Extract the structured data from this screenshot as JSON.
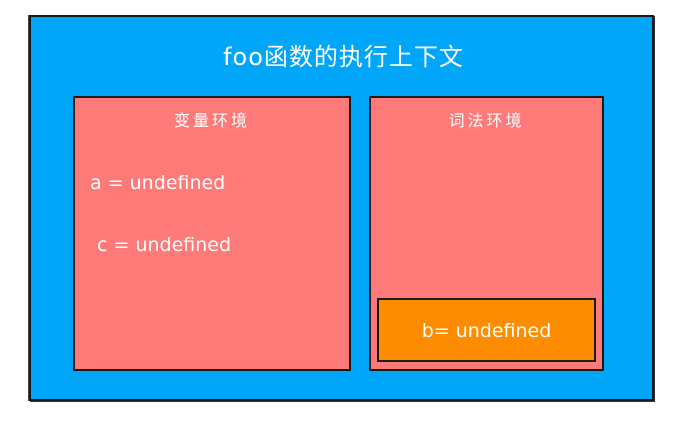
{
  "context": {
    "title": "foo函数的执行上下文",
    "color": "#02a6f8"
  },
  "variable_environment": {
    "title": "变量环境",
    "color": "#fe7a79",
    "bindings": [
      "a = undefined",
      "c = undefined"
    ]
  },
  "lexical_environment": {
    "title": "词法环境",
    "color": "#fe7a79",
    "block": {
      "text": "b= undefined",
      "color": "#fe8c01"
    }
  }
}
